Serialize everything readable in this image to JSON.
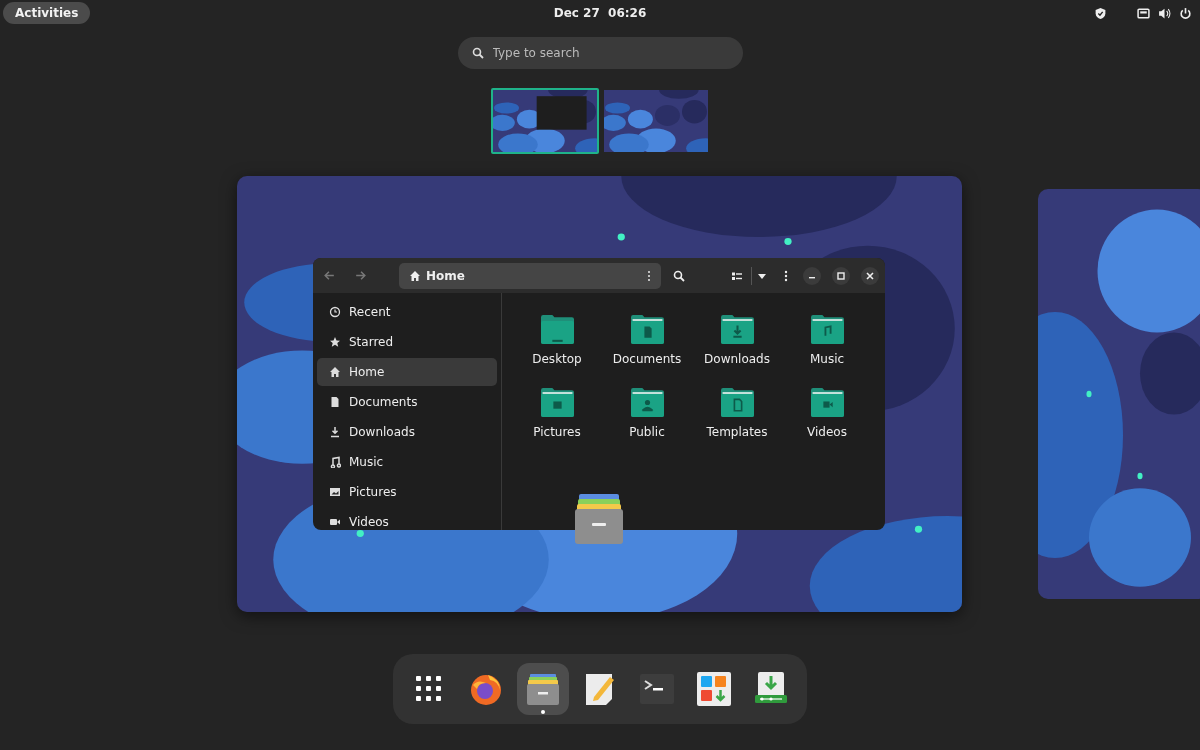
{
  "top_bar": {
    "activities": "Activities",
    "clock": "Dec 27  06:26"
  },
  "search": {
    "placeholder": "Type to search"
  },
  "workspaces": [
    {
      "selected": true,
      "has_window": true
    },
    {
      "selected": false,
      "has_window": false
    }
  ],
  "file_window": {
    "location": "Home",
    "sidebar": [
      {
        "label": "Recent",
        "kind": "recent",
        "selected": false
      },
      {
        "label": "Starred",
        "kind": "star",
        "selected": false
      },
      {
        "label": "Home",
        "kind": "home",
        "selected": true
      },
      {
        "label": "Documents",
        "kind": "document",
        "selected": false
      },
      {
        "label": "Downloads",
        "kind": "download",
        "selected": false
      },
      {
        "label": "Music",
        "kind": "music",
        "selected": false
      },
      {
        "label": "Pictures",
        "kind": "picture",
        "selected": false
      },
      {
        "label": "Videos",
        "kind": "video",
        "selected": false
      }
    ],
    "folders": [
      {
        "name": "Desktop",
        "kind": "desktop"
      },
      {
        "name": "Documents",
        "kind": "document"
      },
      {
        "name": "Downloads",
        "kind": "download"
      },
      {
        "name": "Music",
        "kind": "music"
      },
      {
        "name": "Pictures",
        "kind": "picture"
      },
      {
        "name": "Public",
        "kind": "public"
      },
      {
        "name": "Templates",
        "kind": "template"
      },
      {
        "name": "Videos",
        "kind": "video"
      }
    ]
  },
  "dock": [
    {
      "kind": "apps",
      "running": false,
      "selected": false
    },
    {
      "kind": "browser",
      "running": false,
      "selected": false
    },
    {
      "kind": "files",
      "running": true,
      "selected": true
    },
    {
      "kind": "editor",
      "running": false,
      "selected": false
    },
    {
      "kind": "terminal",
      "running": false,
      "selected": false
    },
    {
      "kind": "software",
      "running": false,
      "selected": false
    },
    {
      "kind": "installer",
      "running": false,
      "selected": false
    }
  ]
}
